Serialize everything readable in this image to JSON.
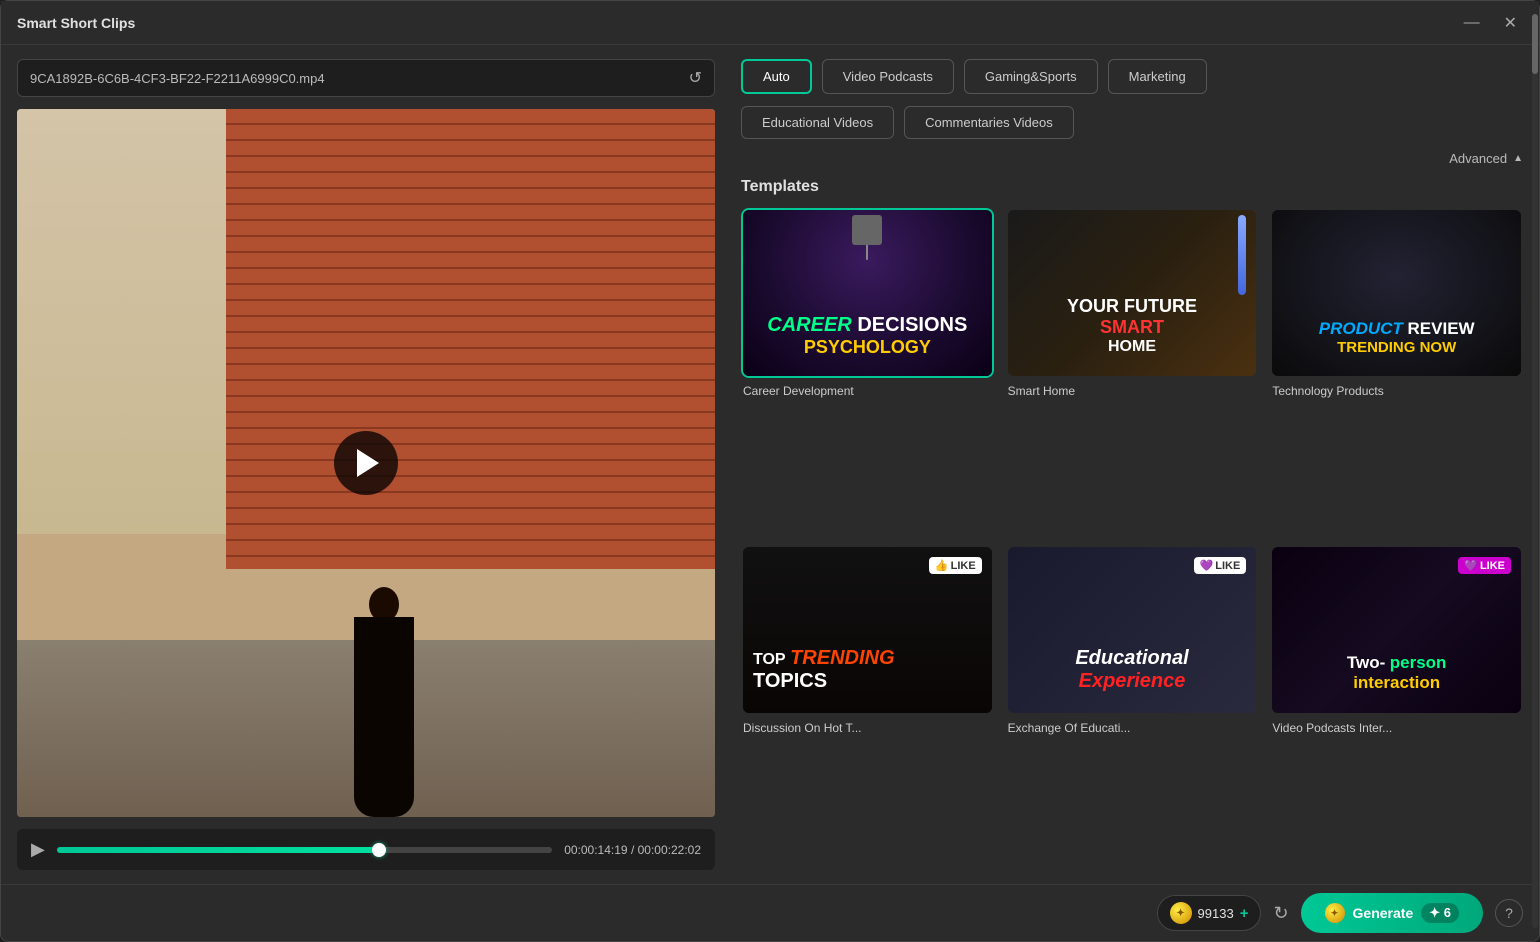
{
  "window": {
    "title": "Smart Short Clips",
    "minimize_label": "—",
    "close_label": "✕"
  },
  "file_bar": {
    "filename": "9CA1892B-6C6B-4CF3-BF22-F2211A6999C0.mp4",
    "reload_icon": "↺"
  },
  "video_controls": {
    "play_icon": "▶",
    "current_time": "00:00:14:19",
    "total_time": "/ 00:00:22:02",
    "progress_percent": 65
  },
  "mode_buttons": {
    "row1": [
      {
        "label": "Auto",
        "active": true
      },
      {
        "label": "Video Podcasts",
        "active": false
      },
      {
        "label": "Gaming&Sports",
        "active": false
      },
      {
        "label": "Marketing",
        "active": false
      }
    ],
    "row2": [
      {
        "label": "Educational Videos",
        "active": false
      },
      {
        "label": "Commentaries Videos",
        "active": false
      }
    ],
    "advanced_label": "Advanced",
    "advanced_arrow": "▲"
  },
  "templates": {
    "section_label": "Templates",
    "items": [
      {
        "id": "career-development",
        "name": "Career Development",
        "selected": true,
        "text_line1_a": "CAREER",
        "text_line1_b": "DECISIONS",
        "text_line2": "PSYCHOLOGY"
      },
      {
        "id": "smart-home",
        "name": "Smart Home",
        "selected": false,
        "text_line1": "YOUR FUTURE",
        "text_line2_a": "SMART",
        "text_line2_b": "HOME"
      },
      {
        "id": "technology-products",
        "name": "Technology Products",
        "selected": false,
        "text_line1_a": "PRODUCT",
        "text_line1_b": "REVIEW",
        "text_line2": "TRENDING NOW"
      },
      {
        "id": "discussion-hot-topics",
        "name": "Discussion On Hot T...",
        "selected": false,
        "text_top": "TOP",
        "text_trending": "TRENDING",
        "text_topics": "TOPICS"
      },
      {
        "id": "exchange-educational",
        "name": "Exchange Of Educati...",
        "selected": false,
        "text_line1": "Educational",
        "text_line2": "Experience"
      },
      {
        "id": "video-podcasts-inter",
        "name": "Video Podcasts Inter...",
        "selected": false,
        "text_line1": "Two-person",
        "text_line2": "interaction"
      }
    ]
  },
  "bottom_bar": {
    "coins": "99133",
    "coin_icon": "✦",
    "plus_icon": "+",
    "refresh_icon": "↻",
    "generate_label": "Generate",
    "generate_count": "6",
    "help_icon": "?"
  }
}
